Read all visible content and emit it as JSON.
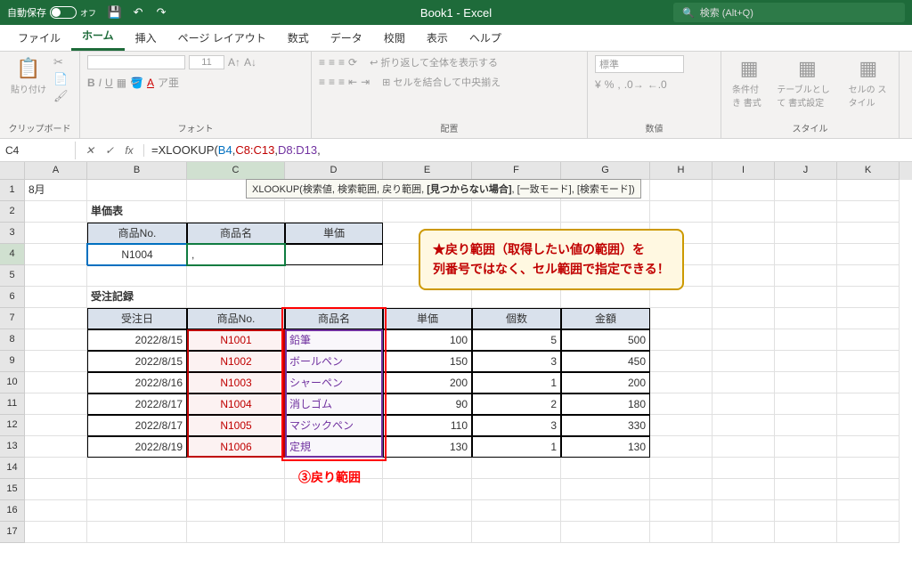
{
  "titlebar": {
    "autosave_label": "自動保存",
    "autosave_state": "オフ",
    "title": "Book1 - Excel",
    "search_placeholder": "検索 (Alt+Q)"
  },
  "tabs": [
    "ファイル",
    "ホーム",
    "挿入",
    "ページ レイアウト",
    "数式",
    "データ",
    "校閲",
    "表示",
    "ヘルプ"
  ],
  "ribbon": {
    "clipboard": {
      "paste": "貼り付け",
      "label": "クリップボード"
    },
    "font": {
      "label": "フォント",
      "bold": "B",
      "italic": "I",
      "underline": "U"
    },
    "align": {
      "label": "配置",
      "wrap": "折り返して全体を表示する",
      "merge": "セルを結合して中央揃え"
    },
    "number": {
      "label": "数値",
      "sel": "標準"
    },
    "style": {
      "label": "スタイル",
      "cond": "条件付き\n書式",
      "table": "テーブルとして\n書式設定",
      "cell": "セルの\nスタイル"
    }
  },
  "formula": {
    "namebox": "C4",
    "prefix": "=XLOOKUP(",
    "arg1": "B4",
    "arg2": "C8:C13",
    "arg3": "D8:D13",
    "suffix": ",",
    "tooltip_pre": "XLOOKUP(検索値, 検索範囲, 戻り範囲, ",
    "tooltip_bold": "[見つからない場合]",
    "tooltip_post": ", [一致モード], [検索モード])"
  },
  "sheet": {
    "a1": "8月",
    "b2": "単価表",
    "b3": "商品No.",
    "c3": "商品名",
    "d3": "単価",
    "b4": "N1004",
    "c4": ",",
    "b6": "受注記録",
    "h7": {
      "b": "受注日",
      "c": "商品No.",
      "d": "商品名",
      "e": "単価",
      "f": "個数",
      "g": "金額"
    },
    "r8": {
      "b": "2022/8/15",
      "c": "N1001",
      "d": "鉛筆",
      "e": "100",
      "f": "5",
      "g": "500"
    },
    "r9": {
      "b": "2022/8/15",
      "c": "N1002",
      "d": "ボールペン",
      "e": "150",
      "f": "3",
      "g": "450"
    },
    "r10": {
      "b": "2022/8/16",
      "c": "N1003",
      "d": "シャーペン",
      "e": "200",
      "f": "1",
      "g": "200"
    },
    "r11": {
      "b": "2022/8/17",
      "c": "N1004",
      "d": "消しゴム",
      "e": "90",
      "f": "2",
      "g": "180"
    },
    "r12": {
      "b": "2022/8/17",
      "c": "N1005",
      "d": "マジックペン",
      "e": "110",
      "f": "3",
      "g": "330"
    },
    "r13": {
      "b": "2022/8/19",
      "c": "N1006",
      "d": "定規",
      "e": "130",
      "f": "1",
      "g": "130"
    }
  },
  "callout": {
    "line1": "★戻り範囲（取得したい値の範囲）を",
    "line2": "列番号ではなく、セル範囲で指定できる！"
  },
  "annotation": "③戻り範囲"
}
